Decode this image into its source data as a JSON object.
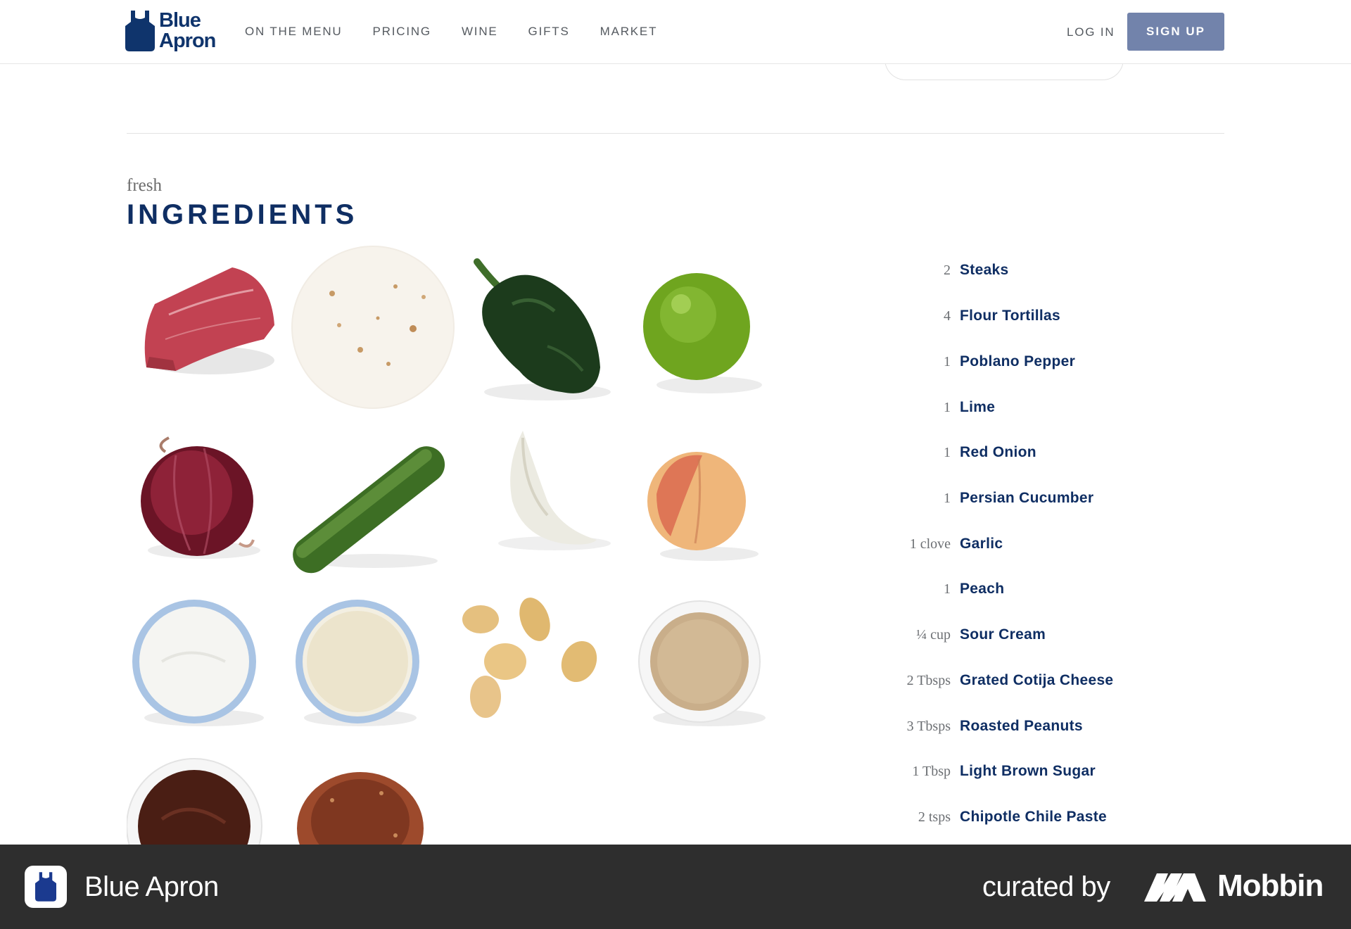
{
  "brand": {
    "line1": "Blue",
    "line2": "Apron",
    "color": "#0f346c"
  },
  "nav": {
    "links": [
      "ON THE MENU",
      "PRICING",
      "WINE",
      "GIFTS",
      "MARKET"
    ],
    "login": "LOG IN",
    "signup": "SIGN UP",
    "signup_color": "#7283ab"
  },
  "section": {
    "eyebrow": "fresh",
    "title": "INGREDIENTS"
  },
  "ingredients": [
    {
      "qty": "2",
      "name": "Steaks"
    },
    {
      "qty": "4",
      "name": "Flour Tortillas"
    },
    {
      "qty": "1",
      "name": "Poblano Pepper"
    },
    {
      "qty": "1",
      "name": "Lime"
    },
    {
      "qty": "1",
      "name": "Red Onion"
    },
    {
      "qty": "1",
      "name": "Persian Cucumber"
    },
    {
      "qty": "1 clove",
      "name": "Garlic"
    },
    {
      "qty": "1",
      "name": "Peach"
    },
    {
      "qty": "¼ cup",
      "name": "Sour Cream"
    },
    {
      "qty": "2 Tbsps",
      "name": "Grated Cotija Cheese"
    },
    {
      "qty": "3 Tbsps",
      "name": "Roasted Peanuts"
    },
    {
      "qty": "1 Tbsp",
      "name": "Light Brown Sugar"
    },
    {
      "qty": "2 tsps",
      "name": "Chipotle Chile Paste"
    }
  ],
  "ingredient_images": [
    "steak",
    "flour-tortilla",
    "poblano-pepper",
    "lime",
    "red-onion",
    "persian-cucumber",
    "garlic",
    "peach",
    "sour-cream",
    "cotija-cheese",
    "roasted-peanuts",
    "light-brown-sugar",
    "chipotle-chile-paste",
    "spice-blend"
  ],
  "footer": {
    "app_name": "Blue Apron",
    "curated_by": "curated by",
    "mobbin": "Mobbin"
  }
}
